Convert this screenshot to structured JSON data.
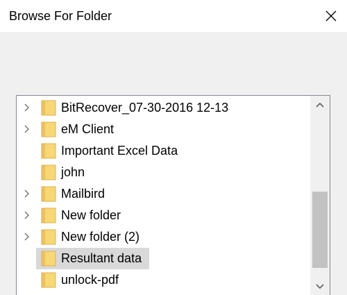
{
  "dialog": {
    "title": "Browse For Folder"
  },
  "tree": {
    "items": [
      {
        "label": "BitRecover_07-30-2016 12-13",
        "has_children": true,
        "selected": false
      },
      {
        "label": "eM Client",
        "has_children": true,
        "selected": false
      },
      {
        "label": "Important Excel Data",
        "has_children": false,
        "selected": false
      },
      {
        "label": "john",
        "has_children": false,
        "selected": false
      },
      {
        "label": "Mailbird",
        "has_children": true,
        "selected": false
      },
      {
        "label": "New folder",
        "has_children": true,
        "selected": false
      },
      {
        "label": "New folder (2)",
        "has_children": true,
        "selected": false
      },
      {
        "label": "Resultant data",
        "has_children": false,
        "selected": true
      },
      {
        "label": "unlock-pdf",
        "has_children": false,
        "selected": false
      }
    ]
  },
  "colors": {
    "folder_fill": "#f8d775",
    "folder_edge": "#e0b14a",
    "selection": "#d9d9d9",
    "scroll_thumb": "#c2c2c2"
  },
  "icons": {
    "close": "close-icon",
    "expander": "chevron-right-icon",
    "folder": "folder-icon",
    "scroll_up": "chevron-up-icon",
    "scroll_down": "chevron-down-icon"
  }
}
